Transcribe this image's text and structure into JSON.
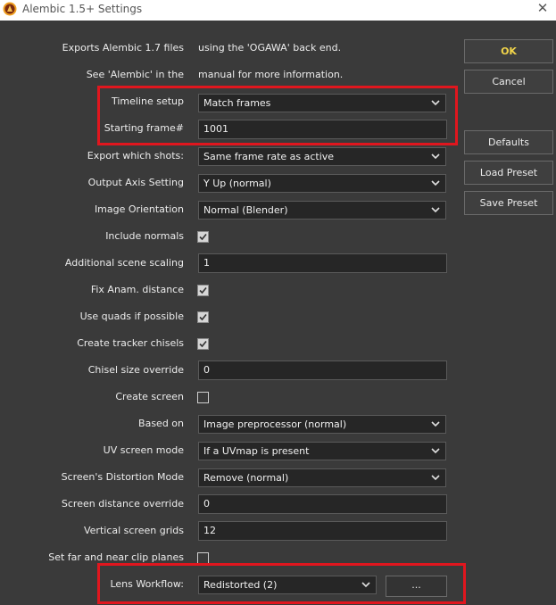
{
  "window": {
    "title": "Alembic 1.5+ Settings"
  },
  "info": {
    "line1_left": "Exports Alembic 1.7 files",
    "line1_right": "using the 'OGAWA' back end.",
    "line2_left": "See 'Alembic' in the",
    "line2_right": "manual for more information."
  },
  "fields": {
    "timeline_setup": {
      "label": "Timeline setup",
      "value": "Match frames"
    },
    "starting_frame": {
      "label": "Starting frame#",
      "value": "1001"
    },
    "export_which_shots": {
      "label": "Export which shots:",
      "value": "Same frame rate as active"
    },
    "output_axis": {
      "label": "Output Axis Setting",
      "value": "Y Up (normal)"
    },
    "image_orientation": {
      "label": "Image Orientation",
      "value": "Normal (Blender)"
    },
    "include_normals": {
      "label": "Include normals",
      "checked": true
    },
    "scene_scaling": {
      "label": "Additional scene scaling",
      "value": "1"
    },
    "fix_anam": {
      "label": "Fix Anam. distance",
      "checked": true
    },
    "use_quads": {
      "label": "Use quads if possible",
      "checked": true
    },
    "tracker_chisels": {
      "label": "Create tracker chisels",
      "checked": true
    },
    "chisel_size": {
      "label": "Chisel size override",
      "value": "0"
    },
    "create_screen": {
      "label": "Create screen",
      "checked": false
    },
    "based_on": {
      "label": "Based on",
      "value": "Image preprocessor (normal)"
    },
    "uv_screen_mode": {
      "label": "UV screen mode",
      "value": "If a UVmap is present"
    },
    "distortion_mode": {
      "label": "Screen's Distortion Mode",
      "value": "Remove (normal)"
    },
    "screen_distance": {
      "label": "Screen distance override",
      "value": "0"
    },
    "vertical_grids": {
      "label": "Vertical screen grids",
      "value": "12"
    },
    "clip_planes": {
      "label": "Set far and near clip planes",
      "checked": false
    },
    "lens_workflow": {
      "label": "Lens Workflow:",
      "value": "Redistorted (2)",
      "button": "..."
    }
  },
  "buttons": {
    "ok": "OK",
    "cancel": "Cancel",
    "defaults": "Defaults",
    "load_preset": "Load Preset",
    "save_preset": "Save Preset"
  },
  "colors": {
    "highlight": "#e0161e",
    "ok_text": "#f1d44a",
    "background": "#3a3a3a"
  }
}
